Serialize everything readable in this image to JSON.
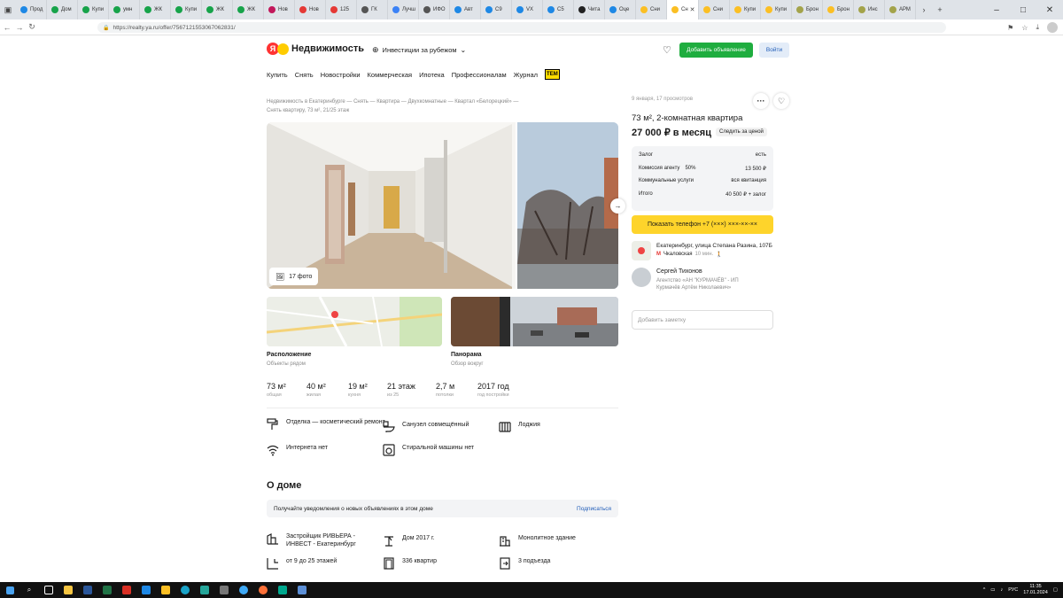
{
  "browser": {
    "tabs": [
      {
        "label": "Прод",
        "color": "#1e88e5"
      },
      {
        "label": "Дом",
        "color": "#17a34a"
      },
      {
        "label": "Купи",
        "color": "#17a34a"
      },
      {
        "label": "умн",
        "color": "#17a34a"
      },
      {
        "label": "ЖК",
        "color": "#17a34a"
      },
      {
        "label": "Купи",
        "color": "#17a34a"
      },
      {
        "label": "ЖК",
        "color": "#17a34a"
      },
      {
        "label": "ЖК",
        "color": "#17a34a"
      },
      {
        "label": "Нов",
        "color": "#c2185b"
      },
      {
        "label": "Нов",
        "color": "#e53935"
      },
      {
        "label": "125",
        "color": "#e53935"
      },
      {
        "label": "ГК",
        "color": "#555555"
      },
      {
        "label": "Лучш",
        "color": "#3b82f6"
      },
      {
        "label": "ИФО",
        "color": "#555555"
      },
      {
        "label": "Авт",
        "color": "#1e88e5"
      },
      {
        "label": "С9",
        "color": "#1e88e5"
      },
      {
        "label": "VX",
        "color": "#1e88e5"
      },
      {
        "label": "С5",
        "color": "#1e88e5"
      },
      {
        "label": "Читa",
        "color": "#222222"
      },
      {
        "label": "Оце",
        "color": "#1e88e5"
      },
      {
        "label": "Сни",
        "color": "#fbbf24"
      },
      {
        "label": "Сн",
        "color": "#fbbf24",
        "active": true
      },
      {
        "label": "Сни",
        "color": "#fbbf24"
      },
      {
        "label": "Купи",
        "color": "#fbbf24"
      },
      {
        "label": "Купи",
        "color": "#fbbf24"
      },
      {
        "label": "Брон",
        "color": "#a3a34a"
      },
      {
        "label": "Брон",
        "color": "#fbbf24"
      },
      {
        "label": "Инс",
        "color": "#a3a34a"
      },
      {
        "label": "АРМ",
        "color": "#a3a34a"
      }
    ],
    "url": "https://realty.ya.ru/offer/7567121553067062831/"
  },
  "header": {
    "brand": "Недвижимость",
    "invest": "Инвестиции за рубежом",
    "add_button": "Добавить объявление",
    "login_button": "Войти"
  },
  "nav": {
    "items": [
      "Купить",
      "Снять",
      "Новостройки",
      "Коммерческая",
      "Ипотека",
      "Профессионалам",
      "Журнал"
    ],
    "tem_badge": "ТЕМ"
  },
  "breadcrumbs": {
    "line1": "Недвижимость в Екатеринбурге — Снять — Квартира — Двухкомнатные — Квартал «Белорецкий» —",
    "line2": "Снять квартиру, 73 м², 21/25 этаж"
  },
  "gallery": {
    "photo_count": "17 фото"
  },
  "cards": {
    "location_title": "Расположение",
    "location_sub": "Объекты рядом",
    "panorama_title": "Панорама",
    "panorama_sub": "Обзор вокруг"
  },
  "stats": [
    {
      "value": "73 м²",
      "label": "общая"
    },
    {
      "value": "40 м²",
      "label": "жилая"
    },
    {
      "value": "19 м²",
      "label": "кухня"
    },
    {
      "value": "21 этаж",
      "label": "из 25"
    },
    {
      "value": "2,7 м",
      "label": "потолки"
    },
    {
      "value": "2017 год",
      "label": "год постройки"
    }
  ],
  "features": {
    "repair": "Отделка — косметический ремонт",
    "bathroom": "Санузел совмещённый",
    "loggia": "Лоджия",
    "internet": "Интернета нет",
    "washer": "Стиральной машины нет"
  },
  "about": {
    "title": "О доме",
    "notify_text": "Получайте уведомления о новых объявлениях в этом доме",
    "notify_link": "Подписаться",
    "developer": "Застройщик РИВЬЕРА - ИНВЕСТ - Екатеринбург",
    "house_year": "Дом 2017 г.",
    "building_type": "Монолитное здание",
    "floors": "от 9 до 25 этажей",
    "apartments": "336 квартир",
    "entrances": "3 подъезда"
  },
  "offer": {
    "meta": "9 января, 17 просмотров",
    "title": "73 м², 2-комнатная квартира",
    "price": "27 000 ₽ в месяц",
    "follow": "Следить за ценой",
    "pricebox": [
      {
        "label": "Залог",
        "mid": "",
        "value": "есть"
      },
      {
        "label": "Комиссия агенту",
        "mid": "50%",
        "value": "13 500 ₽"
      },
      {
        "label": "Коммунальные услуги",
        "mid": "",
        "value": "вся квитанция"
      },
      {
        "label": "Итого",
        "mid": "",
        "value": "40 500 ₽ + залог"
      }
    ],
    "phone_button": "Показать телефон +7 (×××) ×××-××-××",
    "address": "Екатеринбург, улица Степана Разина, 107Б",
    "metro": "Чкаловская",
    "metro_time": "10 мин.",
    "agent_name": "Сергей Тихонов",
    "agent_company": "Агентство «АН \"КУРМАЧЁВ\" - ИП Курмачёв Артём Николаевич»",
    "note_placeholder": "Добавить заметку"
  },
  "taskbar": {
    "lang": "РУС",
    "time": "11:35",
    "date": "17.01.2024"
  }
}
